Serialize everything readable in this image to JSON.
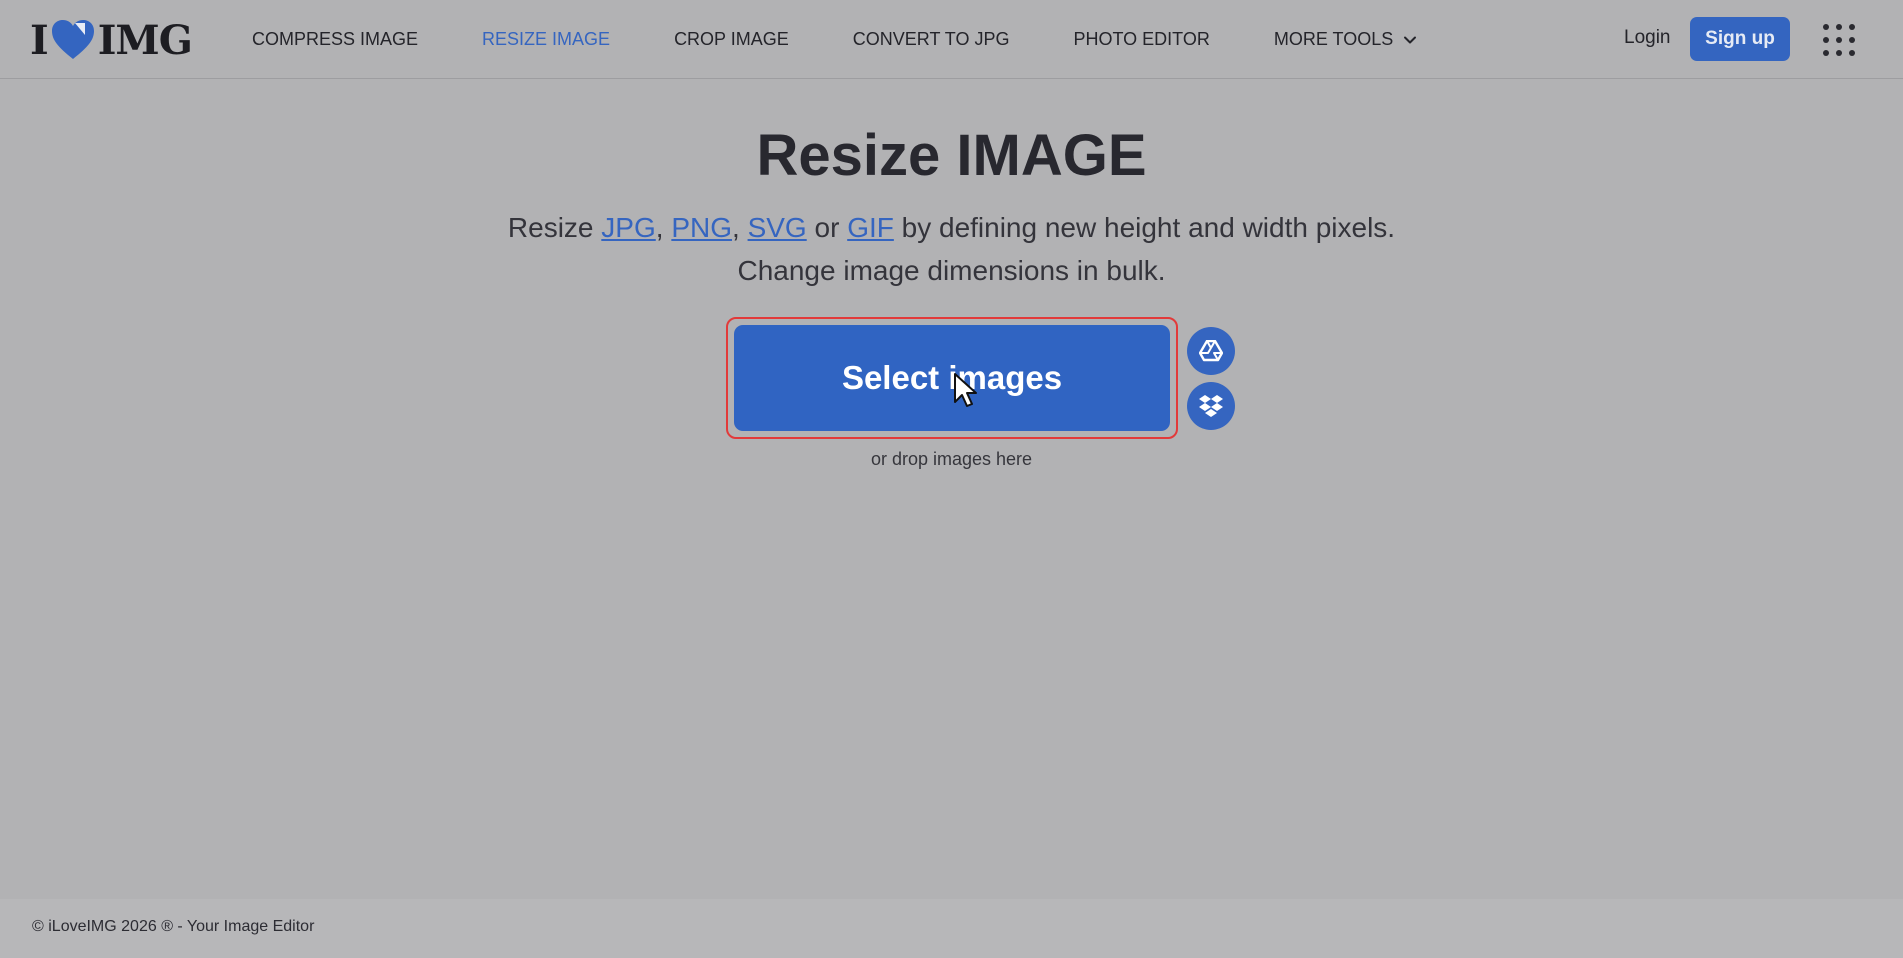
{
  "brand": {
    "logo_left": "I",
    "logo_right": "IMG",
    "heart_color": "#3465c0"
  },
  "nav": {
    "items": [
      {
        "label": "COMPRESS IMAGE"
      },
      {
        "label": "RESIZE IMAGE",
        "active": true
      },
      {
        "label": "CROP IMAGE"
      },
      {
        "label": "CONVERT TO JPG"
      },
      {
        "label": "PHOTO EDITOR"
      },
      {
        "label": "MORE TOOLS",
        "icon": "chevron-down-icon"
      }
    ],
    "login_label": "Login",
    "signup_label": "Sign up",
    "apps_icon": "grid-icon"
  },
  "hero": {
    "title": "Resize IMAGE",
    "sub_prefix": "Resize",
    "formats": [
      "JPG",
      "PNG",
      "SVG",
      "GIF"
    ],
    "sep1": ",",
    "sep2": ",",
    "sep_or": "or",
    "sub_suffix": "by defining new height and width pixels.",
    "sub_line2": "Change image dimensions in bulk."
  },
  "upload": {
    "select_label": "Select images",
    "drop_label": "or drop images here",
    "cloud_icons": [
      "google-drive-icon",
      "dropbox-icon"
    ]
  },
  "footer": {
    "text": "© iLoveIMG 2026 ® - Your Image Editor"
  },
  "colors": {
    "accent": "#3465c0",
    "background": "#b2b2b4",
    "highlight_border": "#e23a3a"
  }
}
